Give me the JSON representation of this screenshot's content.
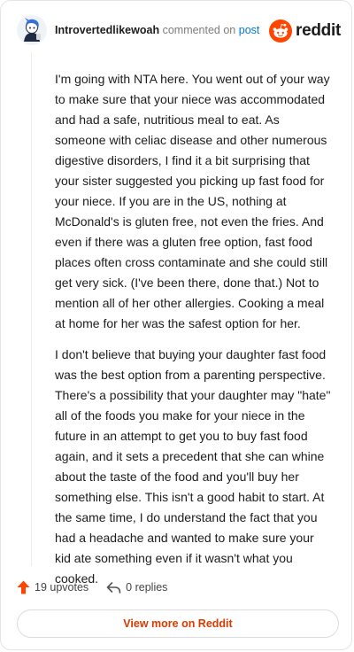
{
  "header": {
    "username": "Introvertedlikewoah",
    "commented_text": "commented on",
    "post_link": "post",
    "brand": "reddit"
  },
  "comment": {
    "paragraphs": [
      "I'm going with NTA here. You went out of your way to make sure that your niece was accommodated and had a safe, nutritious meal to eat. As someone with celiac disease and other numerous digestive disorders, I find it a bit surprising that your sister suggested you picking up fast food for your niece. If you are in the US, nothing at McDonald's is gluten free, not even the fries. And even if there was a gluten free option, fast food places often cross contaminate and she could still get very sick. (I've been there, done that.) Not to mention all of her other allergies. Cooking a meal at home for her was the safest option for her.",
      "I don't believe that buying your daughter fast food was the best option from a parenting perspective. There's a possibility that your daughter may \"hate\" all of the foods you make for your niece in the future in an attempt to get you to buy fast food again, and it sets a precedent that she can whine about the taste of the food and you'll buy her something else. This isn't a good habit to start. At the same time, I do understand the fact that you had a headache and wanted to make sure your kid ate something even if it wasn't what you cooked."
    ]
  },
  "actions": {
    "upvotes": "19 upvotes",
    "replies": "0 replies"
  },
  "footer": {
    "view_button": "View more on Reddit"
  },
  "colors": {
    "brand_orange": "#ff4500",
    "link_blue": "#0079d3",
    "button_text": "#d93a00"
  },
  "icons": {
    "avatar": "avatar-icon",
    "logo": "reddit-logo-icon",
    "upvote": "upvote-arrow-icon",
    "reply": "reply-arrow-icon"
  }
}
